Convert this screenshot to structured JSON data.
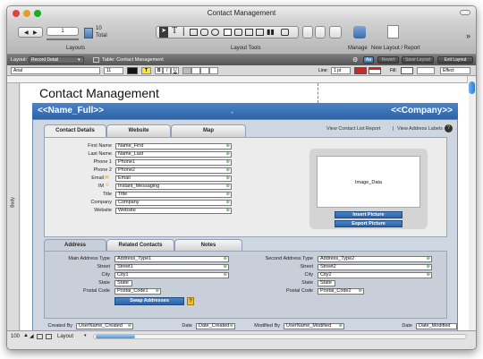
{
  "window": {
    "title": "Contact Management"
  },
  "toolbar": {
    "record_number": "1",
    "record_count": "10",
    "record_total_label": "Total",
    "layouts_label": "Layouts",
    "layout_tools_label": "Layout Tools",
    "manage_label": "Manage",
    "new_layout_label": "New Layout / Report",
    "overflow": "»"
  },
  "layoutbar": {
    "layout_label": "Layout:",
    "layout_value": "Record Detail",
    "table_label": "Table: Contact Management",
    "aa_label": "Aa",
    "revert_label": "Revert",
    "save_label": "Save Layout",
    "exit_label": "Exit Layout"
  },
  "formatbar": {
    "font": "Arial",
    "size": "11",
    "text_color_label": "T",
    "bold": "B",
    "italic": "I",
    "underline": "U",
    "line_label": "Line:",
    "line_value": "1 pt",
    "fill_label": "Fill:",
    "effect_label": "Effect"
  },
  "side_label": "Body",
  "header": {
    "title": "Contact Management"
  },
  "bluebar": {
    "name_full": "<<Name_Full>>",
    "company": "<<Company>>"
  },
  "tabs": [
    "Contact Details",
    "Website",
    "Map"
  ],
  "top_links": {
    "report": "View Contact List Report",
    "sep": "|",
    "labels": "View Address Labels"
  },
  "contact_fields": [
    {
      "label": "First Name",
      "value": "Name_First"
    },
    {
      "label": "Last Name",
      "value": "Name_Last"
    },
    {
      "label": "Phone 1",
      "value": "Phone1"
    },
    {
      "label": "Phone 2",
      "value": "Phone2"
    },
    {
      "label": "Email",
      "value": "Email"
    },
    {
      "label": "IM",
      "value": "Instant_Messaging"
    },
    {
      "label": "Title",
      "value": "Title"
    },
    {
      "label": "Company",
      "value": "Company"
    },
    {
      "label": "Website",
      "value": "Website"
    }
  ],
  "image": {
    "placeholder": "Image_Data",
    "insert_label": "Insert Picture",
    "export_label": "Export Picture"
  },
  "subtabs": [
    "Address",
    "Related Contacts",
    "Notes"
  ],
  "address_left": [
    {
      "label": "Main Address Type",
      "value": "Address_Type1"
    },
    {
      "label": "Street",
      "value": "Street1"
    },
    {
      "label": "City",
      "value": "City1"
    },
    {
      "label": "State",
      "value": "State"
    },
    {
      "label": "Postal Code",
      "value": "Postal_Code1"
    }
  ],
  "address_right": [
    {
      "label": "Second Address Type",
      "value": "Address_Type2"
    },
    {
      "label": "Street",
      "value": "Street2"
    },
    {
      "label": "City",
      "value": "City2"
    },
    {
      "label": "State",
      "value": "State"
    },
    {
      "label": "Postal Code",
      "value": "Postal_Code2"
    }
  ],
  "swap_label": "Swap Addresses",
  "footer_fields": [
    {
      "label": "Created By",
      "value": "UserName_Created"
    },
    {
      "label": "Date",
      "value": "Date_Created"
    },
    {
      "label": "Modified By",
      "value": "UserName_Modified"
    },
    {
      "label": "Date",
      "value": "Date_Modified"
    }
  ],
  "statusbar": {
    "zoom": "100",
    "mode": "Layout"
  }
}
